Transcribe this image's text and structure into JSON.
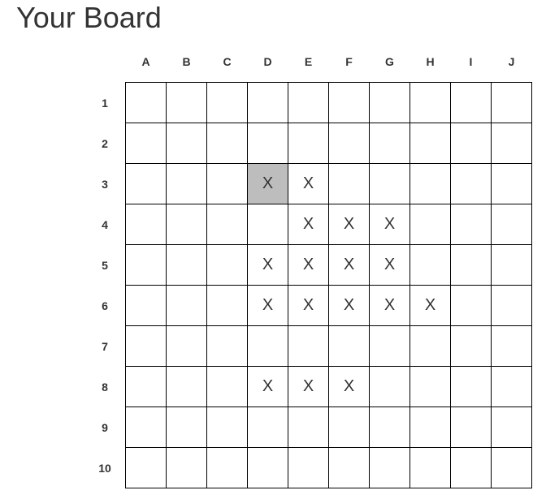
{
  "title": "Your Board",
  "board": {
    "columns": [
      "A",
      "B",
      "C",
      "D",
      "E",
      "F",
      "G",
      "H",
      "I",
      "J"
    ],
    "rows": [
      "1",
      "2",
      "3",
      "4",
      "5",
      "6",
      "7",
      "8",
      "9",
      "10"
    ],
    "cells": [
      [
        "",
        "",
        "",
        "",
        "",
        "",
        "",
        "",
        "",
        ""
      ],
      [
        "",
        "",
        "",
        "",
        "",
        "",
        "",
        "",
        "",
        ""
      ],
      [
        "",
        "",
        "",
        "X",
        "X",
        "",
        "",
        "",
        "",
        ""
      ],
      [
        "",
        "",
        "",
        "",
        "X",
        "X",
        "X",
        "",
        "",
        ""
      ],
      [
        "",
        "",
        "",
        "X",
        "X",
        "X",
        "X",
        "",
        "",
        ""
      ],
      [
        "",
        "",
        "",
        "X",
        "X",
        "X",
        "X",
        "X",
        "",
        ""
      ],
      [
        "",
        "",
        "",
        "",
        "",
        "",
        "",
        "",
        "",
        ""
      ],
      [
        "",
        "",
        "",
        "X",
        "X",
        "X",
        "",
        "",
        "",
        ""
      ],
      [
        "",
        "",
        "",
        "",
        "",
        "",
        "",
        "",
        "",
        ""
      ],
      [
        "",
        "",
        "",
        "",
        "",
        "",
        "",
        "",
        "",
        ""
      ]
    ],
    "selected_cell": "D3",
    "selected_color": "#bdbdbd"
  }
}
